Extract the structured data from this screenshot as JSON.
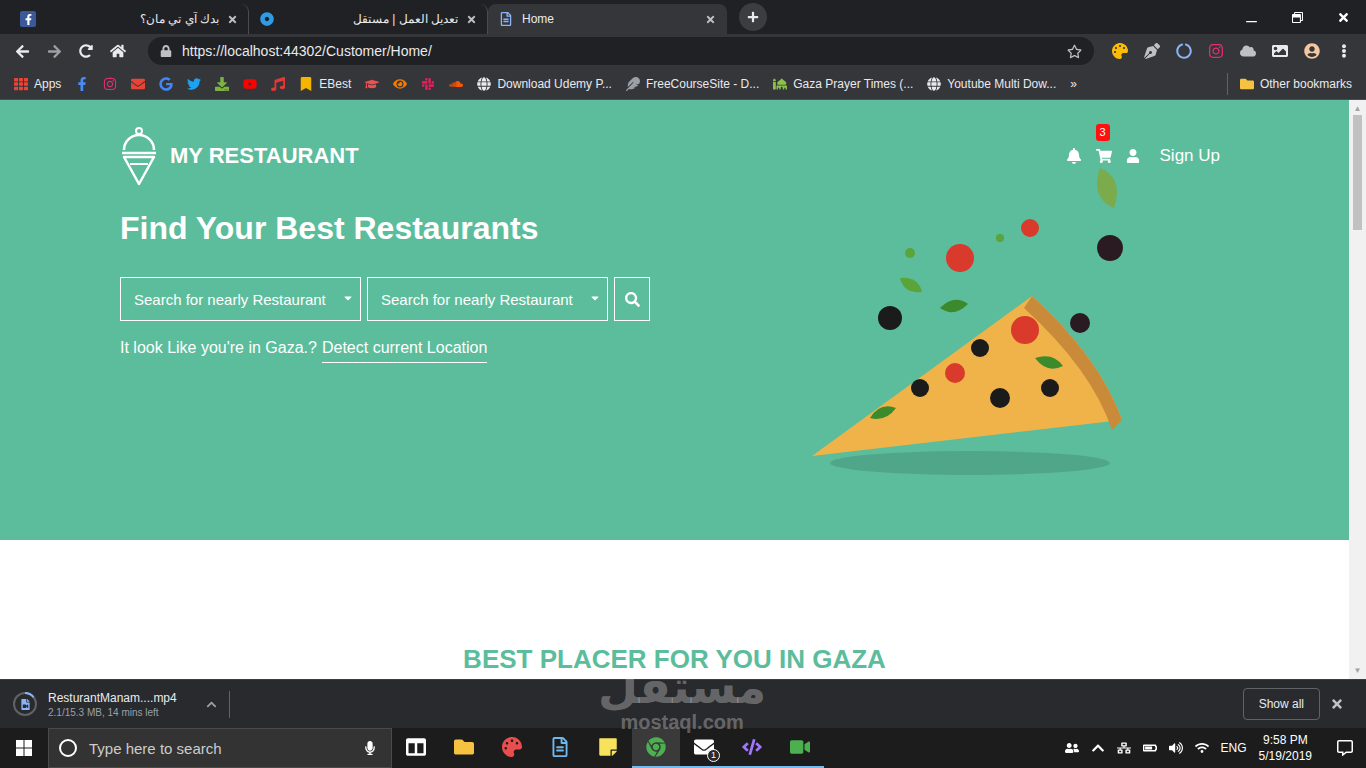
{
  "browser": {
    "tabs": [
      {
        "label": "بدك آي تي مان؟",
        "kind": "facebook",
        "selected": false
      },
      {
        "label": "تعديل العمل | مستقل",
        "kind": "mostaql",
        "selected": false
      },
      {
        "label": "Home",
        "kind": "page",
        "selected": true
      }
    ],
    "url": "https://localhost:44302/Customer/Home/",
    "extensions": [
      {
        "kind": "palette"
      },
      {
        "kind": "pen"
      },
      {
        "kind": "circle"
      },
      {
        "kind": "instagram"
      },
      {
        "kind": "cloud"
      },
      {
        "kind": "photo"
      },
      {
        "kind": "avatar"
      }
    ],
    "bookmarks": [
      {
        "kind": "apps",
        "label": "Apps"
      },
      {
        "kind": "facebook"
      },
      {
        "kind": "instagram"
      },
      {
        "kind": "gmail"
      },
      {
        "kind": "translate"
      },
      {
        "kind": "twitter"
      },
      {
        "kind": "download"
      },
      {
        "kind": "youtube"
      },
      {
        "kind": "music"
      },
      {
        "kind": "ebest",
        "label": "EBest"
      },
      {
        "kind": "udemy"
      },
      {
        "kind": "eye"
      },
      {
        "kind": "slack"
      },
      {
        "kind": "soundcloud"
      },
      {
        "kind": "globe",
        "label": "Download Udemy P..."
      },
      {
        "kind": "fcs",
        "label": "FreeCourseSite - D..."
      },
      {
        "kind": "prayer",
        "label": "Gaza Prayer Times (..."
      },
      {
        "kind": "globe",
        "label": "Youtube Multi Dow..."
      }
    ],
    "bookmarks_overflow": "»",
    "other_bookmarks": "Other bookmarks"
  },
  "page": {
    "logo": "MY RESTAURANT",
    "cart_count": "3",
    "sign_up": "Sign Up",
    "heading": "Find Your Best Restaurants",
    "selects": [
      {
        "placeholder": "Search for nearly Restaurant"
      },
      {
        "placeholder": "Search for nearly Restaurant"
      }
    ],
    "location_text": "It look Like you're in Gaza.?",
    "location_link": "Detect current Location",
    "section_title": "BEST PLACER FOR YOU IN GAZA"
  },
  "download": {
    "file": "ResturantManam....mp4",
    "status": "2.1/15.3 MB, 14 mins left",
    "level": 0.14,
    "show_all": "Show all"
  },
  "taskbar": {
    "search_placeholder": "Type here to search",
    "apps": [
      {
        "kind": "taskview",
        "running": false,
        "selected": false
      },
      {
        "kind": "explorer",
        "running": false,
        "selected": false
      },
      {
        "kind": "paint",
        "running": false,
        "selected": false
      },
      {
        "kind": "notepad",
        "running": false,
        "selected": false
      },
      {
        "kind": "sticky",
        "running": false,
        "selected": false
      },
      {
        "kind": "chrome",
        "running": true,
        "selected": true
      },
      {
        "kind": "mail",
        "running": true,
        "selected": false,
        "badge": "1"
      },
      {
        "kind": "vs",
        "running": true,
        "selected": false
      },
      {
        "kind": "camtasia",
        "running": true,
        "selected": false
      }
    ],
    "tray": [
      {
        "kind": "people"
      },
      {
        "kind": "chevron"
      },
      {
        "kind": "network"
      },
      {
        "kind": "battery"
      },
      {
        "kind": "volume"
      },
      {
        "kind": "wifi"
      }
    ],
    "language": "ENG",
    "time": "9:58 PM",
    "date": "5/19/2019"
  },
  "watermark": {
    "arabic": "مستقل",
    "latin": "mostaql.com"
  }
}
